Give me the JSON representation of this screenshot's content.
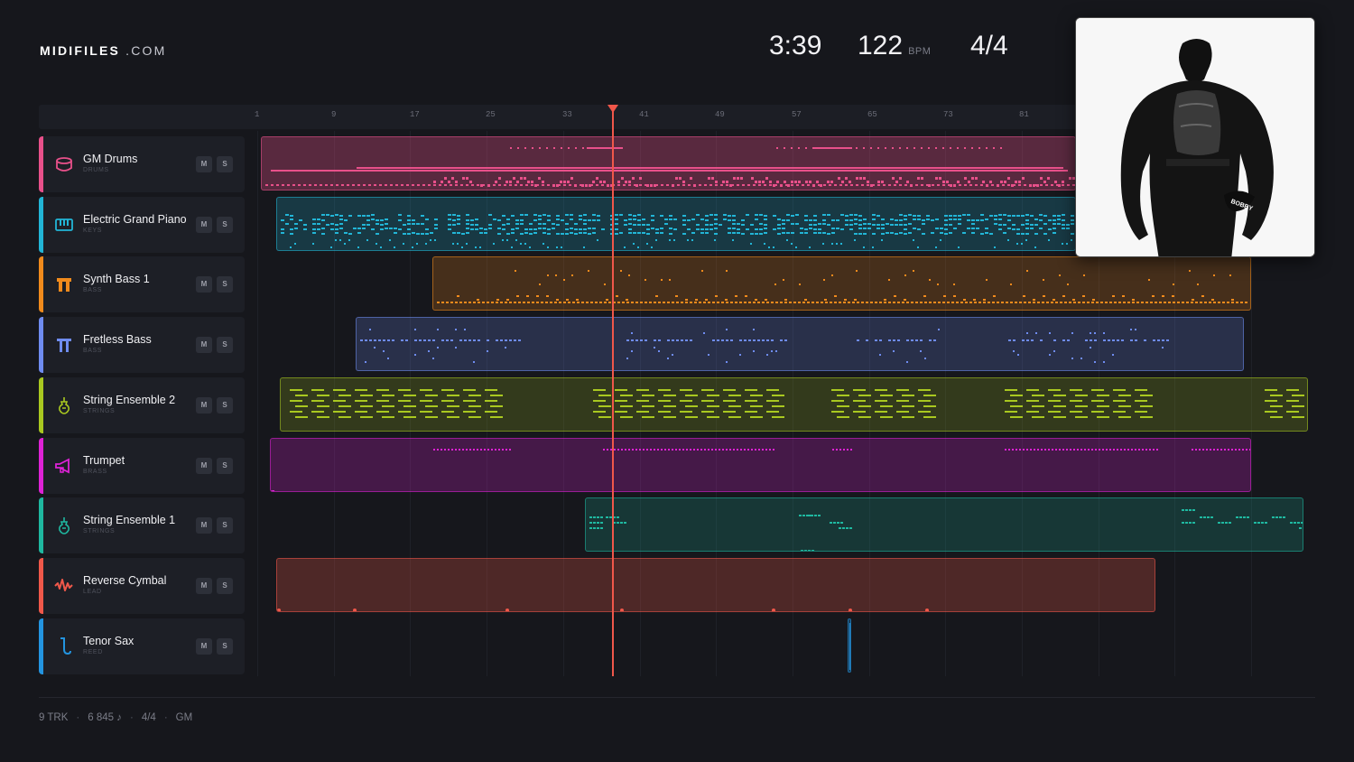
{
  "brand": {
    "name_bold": "MIDIFILES",
    "name_suffix": ".COM"
  },
  "transport": {
    "time": "3:39",
    "tempo": "122",
    "tempo_unit": "BPM",
    "signature": "4/4"
  },
  "ruler": {
    "bars": [
      "1",
      "9",
      "17",
      "25",
      "33",
      "41",
      "49",
      "57",
      "65",
      "73",
      "81"
    ]
  },
  "playhead": {
    "bar": 37
  },
  "colors": {
    "background": "#16171c",
    "playhead": "#f0574a"
  },
  "tracks": [
    {
      "name": "GM Drums",
      "category": "DRUMS",
      "color": "#e8508a",
      "icon": "drum-icon",
      "mute": "M",
      "solo": "S"
    },
    {
      "name": "Electric Grand Piano",
      "category": "KEYS",
      "color": "#22b5d6",
      "icon": "piano-icon",
      "mute": "M",
      "solo": "S"
    },
    {
      "name": "Synth Bass 1",
      "category": "BASS",
      "color": "#f08a1c",
      "icon": "synth-bass-icon",
      "mute": "M",
      "solo": "S"
    },
    {
      "name": "Fretless Bass",
      "category": "BASS",
      "color": "#6f8cf0",
      "icon": "bass-guitar-icon",
      "mute": "M",
      "solo": "S"
    },
    {
      "name": "String Ensemble 2",
      "category": "STRINGS",
      "color": "#a9c820",
      "icon": "violin-icon",
      "mute": "M",
      "solo": "S"
    },
    {
      "name": "Trumpet",
      "category": "BRASS",
      "color": "#de22d6",
      "icon": "trumpet-icon",
      "mute": "M",
      "solo": "S"
    },
    {
      "name": "String Ensemble 1",
      "category": "STRINGS",
      "color": "#1fb8a0",
      "icon": "violin-icon",
      "mute": "M",
      "solo": "S"
    },
    {
      "name": "Reverse Cymbal",
      "category": "LEAD",
      "color": "#f0584a",
      "icon": "waveform-icon",
      "mute": "M",
      "solo": "S"
    },
    {
      "name": "Tenor Sax",
      "category": "REED",
      "color": "#2394e0",
      "icon": "saxophone-icon",
      "mute": "M",
      "solo": "S"
    }
  ],
  "album_art": {
    "text": "BOBBY"
  },
  "footer": {
    "tracks": "9 TRK",
    "notes": "6 845 ♪",
    "signature": "4/4",
    "standard": "GM"
  }
}
